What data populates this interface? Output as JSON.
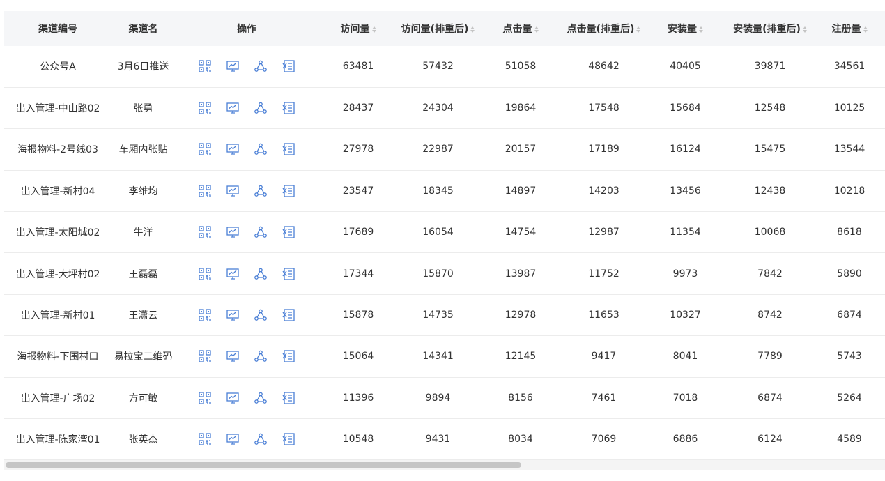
{
  "colors": {
    "icon": "#4a7fd6",
    "header_bg": "#f5f6f8"
  },
  "headers": {
    "channel_id": "渠道编号",
    "channel_name": "渠道名",
    "actions": "操作",
    "visits": "访问量",
    "visits_dedup": "访问量(排重后)",
    "clicks": "点击量",
    "clicks_dedup": "点击量(排重后)",
    "installs": "安装量",
    "installs_dedup": "安装量(排重后)",
    "registrations": "注册量"
  },
  "action_icons": [
    "qrcode-icon",
    "chart-icon",
    "share-icon",
    "excel-export-icon"
  ],
  "rows": [
    {
      "id": "公众号A",
      "name": "3月6日推送",
      "visits": "63481",
      "visits_dedup": "57432",
      "clicks": "51058",
      "clicks_dedup": "48642",
      "installs": "40405",
      "installs_dedup": "39871",
      "registrations": "34561"
    },
    {
      "id": "出入管理-中山路02",
      "name": "张勇",
      "visits": "28437",
      "visits_dedup": "24304",
      "clicks": "19864",
      "clicks_dedup": "17548",
      "installs": "15684",
      "installs_dedup": "12548",
      "registrations": "10125"
    },
    {
      "id": "海报物料-2号线03",
      "name": "车厢内张贴",
      "visits": "27978",
      "visits_dedup": "22987",
      "clicks": "20157",
      "clicks_dedup": "17189",
      "installs": "16124",
      "installs_dedup": "15475",
      "registrations": "13544"
    },
    {
      "id": "出入管理-新村04",
      "name": "李维均",
      "visits": "23547",
      "visits_dedup": "18345",
      "clicks": "14897",
      "clicks_dedup": "14203",
      "installs": "13456",
      "installs_dedup": "12438",
      "registrations": "10218"
    },
    {
      "id": "出入管理-太阳城02",
      "name": "牛洋",
      "visits": "17689",
      "visits_dedup": "16054",
      "clicks": "14754",
      "clicks_dedup": "12987",
      "installs": "11354",
      "installs_dedup": "10068",
      "registrations": "8618"
    },
    {
      "id": "出入管理-大坪村02",
      "name": "王磊磊",
      "visits": "17344",
      "visits_dedup": "15870",
      "clicks": "13987",
      "clicks_dedup": "11752",
      "installs": "9973",
      "installs_dedup": "7842",
      "registrations": "5890"
    },
    {
      "id": "出入管理-新村01",
      "name": "王潇云",
      "visits": "15878",
      "visits_dedup": "14735",
      "clicks": "12978",
      "clicks_dedup": "11653",
      "installs": "10327",
      "installs_dedup": "8742",
      "registrations": "6874"
    },
    {
      "id": "海报物料-下围村口",
      "name": "易拉宝二维码",
      "visits": "15064",
      "visits_dedup": "14341",
      "clicks": "12145",
      "clicks_dedup": "9417",
      "installs": "8041",
      "installs_dedup": "7789",
      "registrations": "5743"
    },
    {
      "id": "出入管理-广场02",
      "name": "方可敏",
      "visits": "11396",
      "visits_dedup": "9894",
      "clicks": "8156",
      "clicks_dedup": "7461",
      "installs": "7018",
      "installs_dedup": "6874",
      "registrations": "5264"
    },
    {
      "id": "出入管理-陈家湾01",
      "name": "张英杰",
      "visits": "10548",
      "visits_dedup": "9431",
      "clicks": "8034",
      "clicks_dedup": "7069",
      "installs": "6886",
      "installs_dedup": "6124",
      "registrations": "4589"
    }
  ]
}
